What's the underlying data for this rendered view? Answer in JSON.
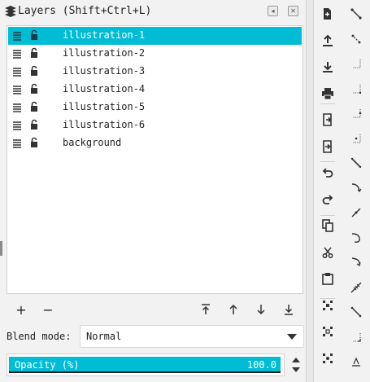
{
  "panel": {
    "title": "Layers (Shift+Ctrl+L)",
    "float_icon": "float-panel-icon",
    "close_icon": "close-panel-icon"
  },
  "layers": [
    {
      "name": "illustration-1",
      "selected": true,
      "visible": true,
      "locked": false
    },
    {
      "name": "illustration-2",
      "selected": false,
      "visible": true,
      "locked": false
    },
    {
      "name": "illustration-3",
      "selected": false,
      "visible": true,
      "locked": false
    },
    {
      "name": "illustration-4",
      "selected": false,
      "visible": true,
      "locked": false
    },
    {
      "name": "illustration-5",
      "selected": false,
      "visible": true,
      "locked": false
    },
    {
      "name": "illustration-6",
      "selected": false,
      "visible": true,
      "locked": false
    },
    {
      "name": "background",
      "selected": false,
      "visible": true,
      "locked": false
    }
  ],
  "list_toolbar": {
    "add_label": "+",
    "remove_label": "−",
    "icons": [
      "raise-to-top-icon",
      "raise-icon",
      "lower-icon",
      "lower-to-bottom-icon"
    ]
  },
  "blend": {
    "label": "Blend mode:",
    "value": "Normal"
  },
  "opacity": {
    "label": "Opacity (%)",
    "value": "100.0",
    "fraction": 1.0
  },
  "colors": {
    "accent": "#00bcd4",
    "panel_bg": "#f2f2f2",
    "list_bg": "#ffffff",
    "text": "#222222"
  },
  "commands_toolbar": [
    "new-document-icon",
    "import-icon",
    "export-icon",
    "print-icon",
    "import-from-icon",
    "export-to-icon",
    "undo-icon",
    "redo-icon",
    "copy-icon",
    "cut-icon",
    "paste-icon",
    "zoom-selection-icon",
    "zoom-drawing-icon",
    "zoom-page-icon"
  ],
  "snap_toolbar": [
    "snap-bbox-icon",
    "snap-bbox-edges-icon",
    "snap-bbox-corners-icon",
    "snap-bbox-edge-mid-icon",
    "snap-bbox-center-icon",
    "snap-nodes-icon",
    "snap-paths-icon",
    "snap-path-intersections-icon",
    "snap-cusp-nodes-icon",
    "snap-smooth-nodes-icon",
    "snap-line-midpoints-icon",
    "snap-others-icon",
    "snap-object-centers-icon",
    "snap-rotation-centers-icon",
    "snap-text-baselines-icon"
  ]
}
